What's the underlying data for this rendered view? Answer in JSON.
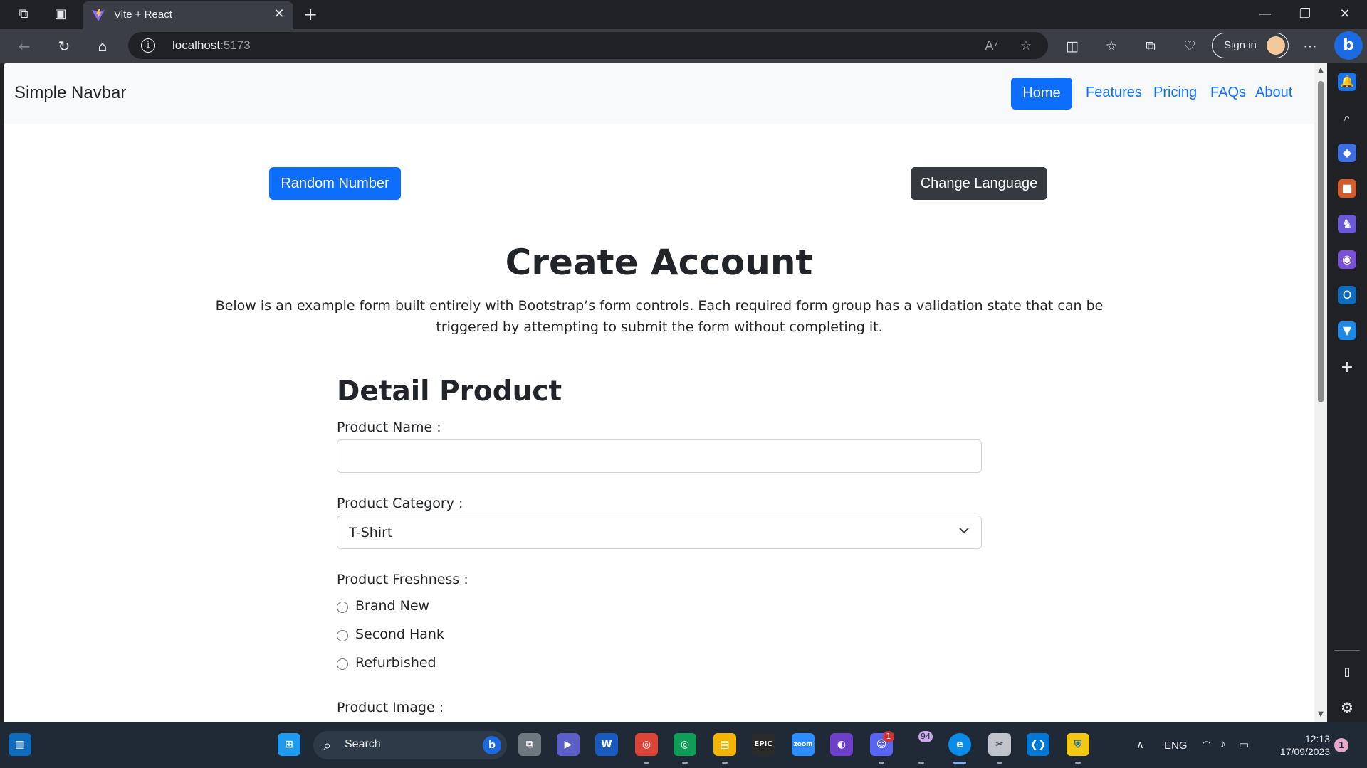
{
  "browser": {
    "tab_title": "Vite + React",
    "url_host": "localhost",
    "url_port": ":5173",
    "signin_label": "Sign in"
  },
  "app": {
    "brand": "Simple Navbar",
    "nav": [
      "Home",
      "Features",
      "Pricing",
      "FAQs",
      "About"
    ],
    "active_nav": "Home",
    "random_button": "Random Number",
    "language_button": "Change Language",
    "title": "Create Account",
    "subtitle": "Below is an example form built entirely with Bootstrap’s form controls. Each required form group has a validation state that can be triggered by attempting to submit the form without completing it."
  },
  "form": {
    "heading": "Detail Product",
    "product_name_label": "Product Name :",
    "product_name_value": "",
    "category_label": "Product Category :",
    "category_value": "T-Shirt",
    "freshness_label": "Product Freshness :",
    "freshness_options": [
      "Brand New",
      "Second Hank",
      "Refurbished"
    ],
    "image_label": "Product Image :"
  },
  "taskbar": {
    "search_placeholder": "Search",
    "discord_badge": "1",
    "notifications_badge": "94",
    "chrome_badge": "",
    "language": "ENG",
    "time": "12:13",
    "date": "17/09/2023",
    "notif_count": "1"
  },
  "colors": {
    "primary": "#0d6efd",
    "dark_button": "#343a40",
    "navbar_bg": "#f8f9fa",
    "taskbar_bg": "#1f2a36"
  }
}
